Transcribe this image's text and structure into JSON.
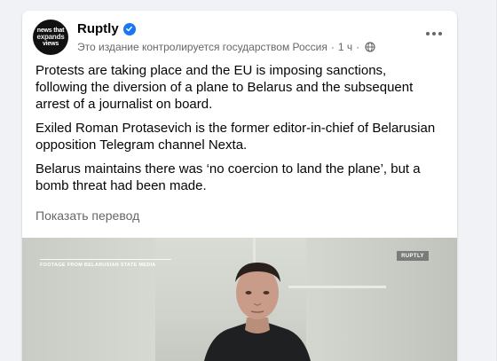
{
  "post": {
    "avatar_lines": [
      "news that",
      "expands",
      "views"
    ],
    "page_name": "Ruptly",
    "state_media_label": "Это издание контролируется государством Россия",
    "separator": "·",
    "time": "1 ч",
    "paragraphs": [
      "Protests are taking place and the EU is imposing sanctions, following the diversion of a plane to Belarus and the subsequent arrest of a journalist on board.",
      "Exiled Roman Protasevich is the former editor-in-chief of Belarusian opposition Telegram channel Nexta.",
      "Belarus maintains there was ‘no coercion to land the plane’, but a bomb threat had been made."
    ],
    "see_translation": "Показать перевод"
  },
  "video": {
    "caption": "FOOTAGE FROM BELARUSIAN STATE MEDIA",
    "logo": "RUPTLY"
  },
  "colors": {
    "page_bg": "#f0f2f5",
    "card_bg": "#ffffff",
    "verified": "#1877f2",
    "secondary_text": "#65676b"
  },
  "icons": [
    "verified-icon",
    "globe-icon",
    "more-icon"
  ]
}
